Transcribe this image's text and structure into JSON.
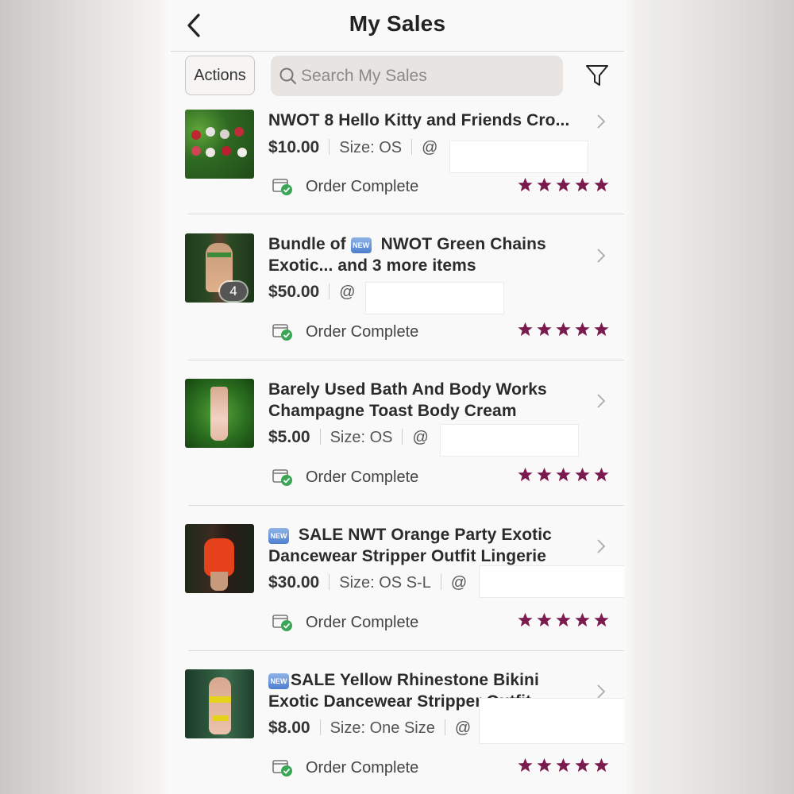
{
  "header": {
    "title": "My Sales"
  },
  "toolbar": {
    "actions_label": "Actions",
    "search_placeholder": "Search My Sales"
  },
  "new_badge": "NEW",
  "items": [
    {
      "title": "NWOT 8 Hello Kitty and Friends Cro...",
      "price": "$10.00",
      "size": "Size: OS",
      "at": "@",
      "status": "Order Complete",
      "rating": 5
    },
    {
      "title_pre": "Bundle of ",
      "title_post": " NWOT Green Chains Exotic... and 3 more items",
      "price": "$50.00",
      "at": "@",
      "count": "4",
      "status": "Order Complete",
      "rating": 5
    },
    {
      "title": "Barely Used Bath And Body Works Champagne Toast Body Cream",
      "price": "$5.00",
      "size": "Size: OS",
      "at": "@",
      "status": "Order Complete",
      "rating": 5
    },
    {
      "title_post": " SALE NWT Orange Party Exotic Dancewear Stripper Outfit Lingerie",
      "price": "$30.00",
      "size": "Size: OS S-L",
      "at": "@",
      "status": "Order Complete",
      "rating": 5
    },
    {
      "title_post": "SALE Yellow Rhinestone Bikini Exotic Dancewear Stripper Outfit",
      "price": "$8.00",
      "size": "Size: One Size",
      "at": "@",
      "status": "Order Complete",
      "rating": 5
    }
  ],
  "colors": {
    "star": "#7b1a4e",
    "check": "#3aa655"
  }
}
